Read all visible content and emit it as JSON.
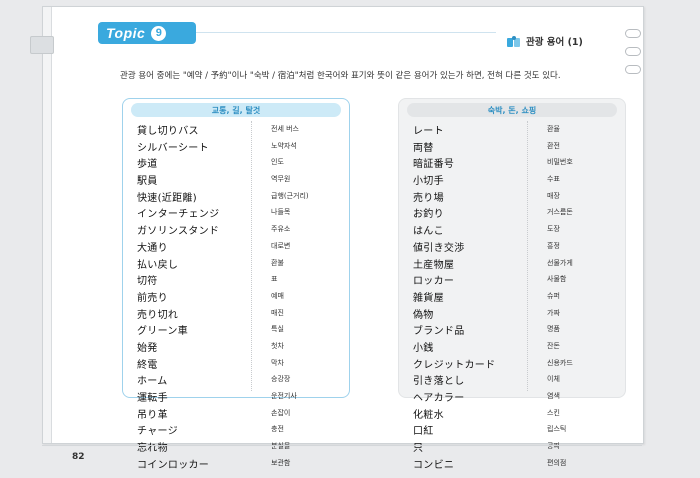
{
  "topic": {
    "word": "Topic",
    "number": "9"
  },
  "header": {
    "title": "관광 용어 (1)"
  },
  "intro": "관광 용어 중에는 \"예약 / 予約\"이나 \"숙박 / 宿泊\"처럼 한국어와 표기와 뜻이 같은 용어가 있는가 하면, 전혀 다른 것도 있다.",
  "left_panel": {
    "heading": "교통, 길, 탈것",
    "rows": [
      {
        "jp": "貸し切りバス",
        "ko": "전세 버스"
      },
      {
        "jp": "シルバーシート",
        "ko": "노약자석"
      },
      {
        "jp": "歩道",
        "ko": "인도"
      },
      {
        "jp": "駅員",
        "ko": "역무원"
      },
      {
        "jp": "快速(近距離)",
        "ko": "급행(근거리)"
      },
      {
        "jp": "インターチェンジ",
        "ko": "나들목"
      },
      {
        "jp": "ガソリンスタンド",
        "ko": "주유소"
      },
      {
        "jp": "大通り",
        "ko": "대로변"
      },
      {
        "jp": "払い戻し",
        "ko": "환불"
      },
      {
        "jp": "切符",
        "ko": "표"
      },
      {
        "jp": "前売り",
        "ko": "예매"
      },
      {
        "jp": "売り切れ",
        "ko": "매진"
      },
      {
        "jp": "グリーン車",
        "ko": "특실"
      },
      {
        "jp": "始発",
        "ko": "첫차"
      },
      {
        "jp": "終電",
        "ko": "막차"
      },
      {
        "jp": "ホーム",
        "ko": "승강장"
      },
      {
        "jp": "運転手",
        "ko": "운전기사"
      },
      {
        "jp": "吊り革",
        "ko": "손잡이"
      },
      {
        "jp": "チャージ",
        "ko": "충전"
      },
      {
        "jp": "忘れ物",
        "ko": "분실물"
      },
      {
        "jp": "コインロッカー",
        "ko": "보관함"
      }
    ]
  },
  "right_panel": {
    "heading": "숙박, 돈, 쇼핑",
    "rows": [
      {
        "jp": "レート",
        "ko": "환율"
      },
      {
        "jp": "両替",
        "ko": "환전"
      },
      {
        "jp": "暗証番号",
        "ko": "비밀번호"
      },
      {
        "jp": "小切手",
        "ko": "수표"
      },
      {
        "jp": "売り場",
        "ko": "매장"
      },
      {
        "jp": "お釣り",
        "ko": "거스름돈"
      },
      {
        "jp": "はんこ",
        "ko": "도장"
      },
      {
        "jp": "値引き交渉",
        "ko": "흥정"
      },
      {
        "jp": "土産物屋",
        "ko": "선물가게"
      },
      {
        "jp": "ロッカー",
        "ko": "사물함"
      },
      {
        "jp": "雑貨屋",
        "ko": "슈퍼"
      },
      {
        "jp": "偽物",
        "ko": "가짜"
      },
      {
        "jp": "ブランド品",
        "ko": "명품"
      },
      {
        "jp": "小銭",
        "ko": "잔돈"
      },
      {
        "jp": "クレジットカード",
        "ko": "신용카드"
      },
      {
        "jp": "引き落とし",
        "ko": "이체"
      },
      {
        "jp": "ヘアカラー",
        "ko": "염색"
      },
      {
        "jp": "化粧水",
        "ko": "스킨"
      },
      {
        "jp": "口紅",
        "ko": "립스틱"
      },
      {
        "jp": "只",
        "ko": "공짜"
      },
      {
        "jp": "コンビニ",
        "ko": "편의점"
      }
    ]
  },
  "page_number": "82"
}
